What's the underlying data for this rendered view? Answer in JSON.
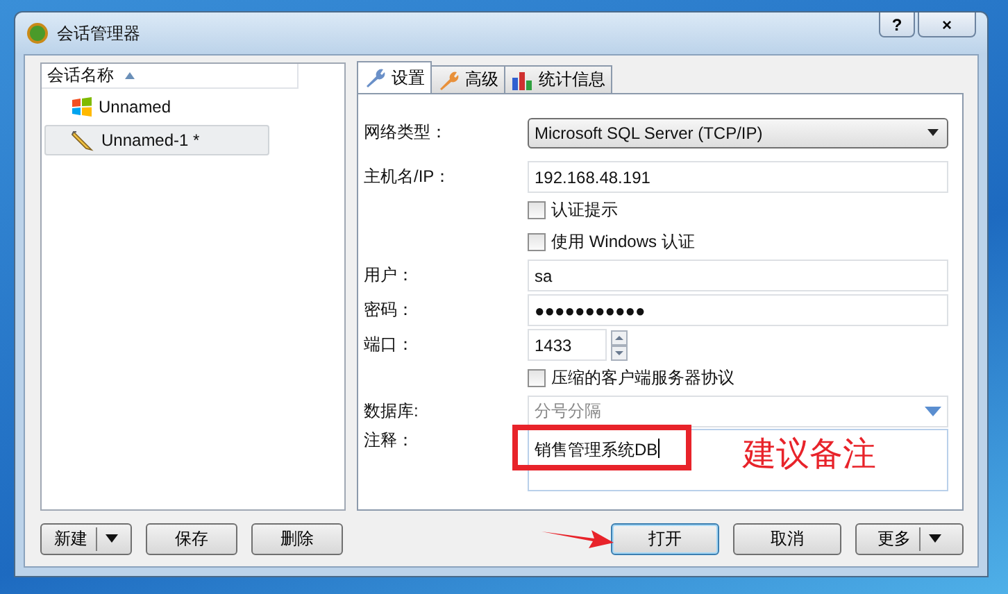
{
  "window": {
    "title": "会话管理器",
    "help_button": "?",
    "close_button": "×"
  },
  "sessions": {
    "column": "会话名称",
    "items": [
      {
        "name": "Unnamed",
        "kind": "windows",
        "selected": false
      },
      {
        "name": "Unnamed-1 *",
        "kind": "edit",
        "selected": true
      }
    ]
  },
  "tabs": [
    {
      "label": "设置",
      "kind": "wrench-blue",
      "selected": true
    },
    {
      "label": "高级",
      "kind": "wrench-orange",
      "selected": false
    },
    {
      "label": "统计信息",
      "kind": "chart",
      "selected": false
    }
  ],
  "form": [
    {
      "kind": "select",
      "label": "网络类型：",
      "value": "Microsoft SQL Server (TCP/IP)"
    },
    {
      "kind": "text",
      "label": "主机名/IP：",
      "value": "192.168.48.191"
    },
    {
      "kind": "checkbox",
      "label": "认证提示",
      "checked": false
    },
    {
      "kind": "checkbox",
      "label": "使用 Windows 认证",
      "checked": false
    },
    {
      "kind": "text",
      "label": "用户：",
      "value": "sa"
    },
    {
      "kind": "text",
      "label": "密码：",
      "value": "●●●●●●●●●●●"
    },
    {
      "kind": "spin",
      "label": "端口：",
      "value": "1433"
    },
    {
      "kind": "checkbox",
      "label": "压缩的客户端服务器协议",
      "checked": false
    },
    {
      "kind": "combo",
      "label": "数据库:",
      "placeholder": "分号分隔"
    },
    {
      "kind": "memo",
      "label": "注释：",
      "value": "销售管理系统DB"
    }
  ],
  "left_buttons": [
    {
      "label": "新建",
      "dropdown": true
    },
    {
      "label": "保存",
      "dropdown": false
    },
    {
      "label": "删除",
      "dropdown": false
    }
  ],
  "right_buttons": [
    {
      "label": "打开",
      "dropdown": false,
      "selected": true
    },
    {
      "label": "取消",
      "dropdown": false,
      "selected": false
    },
    {
      "label": "更多",
      "dropdown": true,
      "selected": false
    }
  ],
  "annotation": {
    "note": "建议备注"
  }
}
